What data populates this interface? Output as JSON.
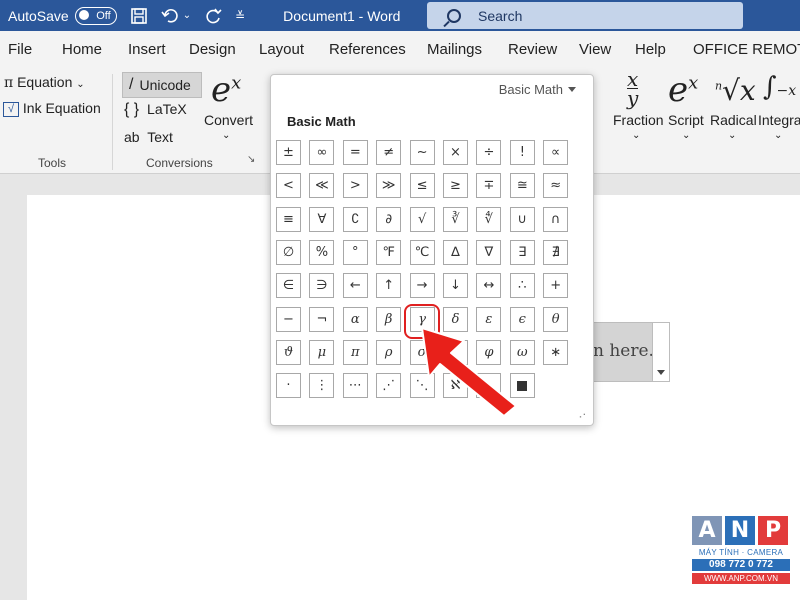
{
  "titlebar": {
    "autosave_label": "AutoSave",
    "autosave_state": "Off",
    "document_title": "Document1  -  Word",
    "search_placeholder": "Search"
  },
  "menu": [
    "File",
    "Home",
    "Insert",
    "Design",
    "Layout",
    "References",
    "Mailings",
    "Review",
    "View",
    "Help",
    "OFFICE REMOTE"
  ],
  "ribbon": {
    "tools": {
      "equation_label": "Equation",
      "ink_equation_label": "Ink Equation",
      "group_label": "Tools"
    },
    "conversions": {
      "unicode_label": "Unicode",
      "latex_label": "LaTeX",
      "text_label": "Text",
      "convert_label": "Convert",
      "group_label": "Conversions"
    },
    "structures": {
      "fraction_label": "Fraction",
      "script_label": "Script",
      "radical_label": "Radical",
      "integral_label": "Integra"
    }
  },
  "symbol_panel": {
    "dropdown_value": "Basic Math",
    "section_title": "Basic Math",
    "rows": [
      [
        "±",
        "∞",
        "=",
        "≠",
        "~",
        "×",
        "÷",
        "!",
        "∝"
      ],
      [
        "<",
        "≪",
        ">",
        "≫",
        "≤",
        "≥",
        "∓",
        "≅",
        "≈"
      ],
      [
        "≡",
        "∀",
        "∁",
        "∂",
        "√",
        "∛",
        "∜",
        "∪",
        "∩"
      ],
      [
        "∅",
        "%",
        "°",
        "℉",
        "℃",
        "∆",
        "∇",
        "∃",
        "∄"
      ],
      [
        "∈",
        "∋",
        "←",
        "↑",
        "→",
        "↓",
        "↔",
        "∴",
        "+"
      ],
      [
        "−",
        "¬",
        "α",
        "β",
        "γ",
        "δ",
        "ε",
        "ϵ",
        "θ"
      ],
      [
        "ϑ",
        "μ",
        "π",
        "ρ",
        "σ",
        "",
        "φ",
        "ω",
        "∗"
      ],
      [
        "·",
        "⋮",
        "⋯",
        "⋰",
        "⋱",
        "ℵ",
        "",
        "■"
      ]
    ],
    "highlighted_symbol": "γ"
  },
  "document": {
    "equation_placeholder_visible": "n here."
  },
  "watermark": {
    "letters": [
      "A",
      "N",
      "P"
    ],
    "subtitle": "MÁY TÍNH · CAMERA",
    "phone": "098 772 0 772",
    "website": "WWW.ANP.COM.VN"
  },
  "colors": {
    "title_bar": "#2b579a",
    "highlight": "#e02020",
    "arrow": "#e8201a"
  }
}
